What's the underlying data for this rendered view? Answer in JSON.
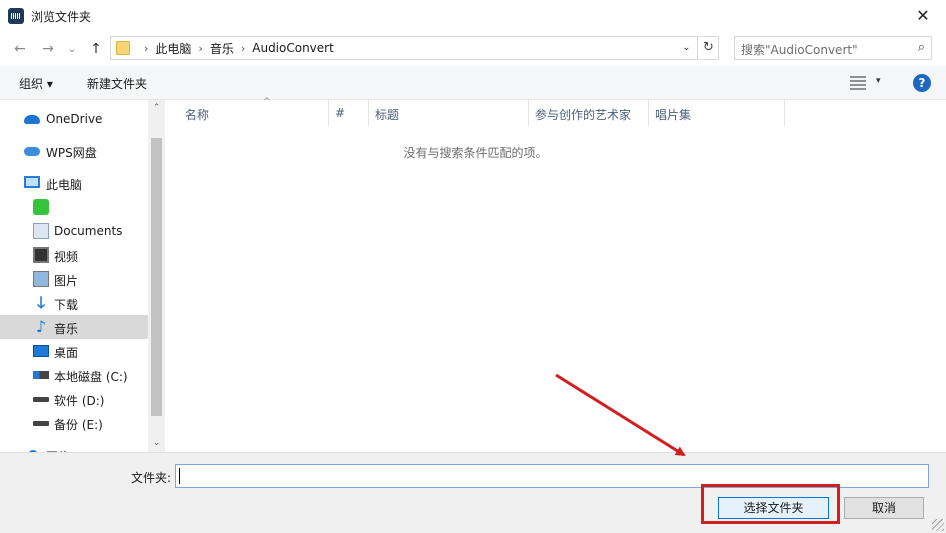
{
  "window": {
    "title": "浏览文件夹",
    "close_glyph": "✕"
  },
  "nav": {
    "back_glyph": "←",
    "forward_glyph": "→",
    "recent_glyph": "⌄",
    "up_glyph": "↑",
    "breadcrumbs": [
      "此电脑",
      "音乐",
      "AudioConvert"
    ],
    "breadcrumb_sep": "›",
    "dropdown_glyph": "⌄",
    "refresh_glyph": "↻",
    "search_placeholder": "搜索\"AudioConvert\"",
    "search_glyph": "⌕"
  },
  "toolbar": {
    "organize_label": "组织 ▾",
    "new_folder_label": "新建文件夹",
    "view_arrow": "▾",
    "help_glyph": "?"
  },
  "sidebar": {
    "items": [
      {
        "label": "OneDrive"
      },
      {
        "label": "WPS网盘"
      },
      {
        "label": "此电脑"
      },
      {
        "label": ""
      },
      {
        "label": "Documents"
      },
      {
        "label": "视频"
      },
      {
        "label": "图片"
      },
      {
        "label": "下载"
      },
      {
        "label": "音乐"
      },
      {
        "label": "桌面"
      },
      {
        "label": "本地磁盘 (C:)"
      },
      {
        "label": "软件 (D:)"
      },
      {
        "label": "备份 (E:)"
      },
      {
        "label": "网络"
      }
    ],
    "selected": "音乐",
    "down_arrow_glyph": "🡓",
    "music_glyph": "♪"
  },
  "scrollbar": {
    "up_glyph": "⌃",
    "down_glyph": "⌄"
  },
  "columns": [
    {
      "label": "名称"
    },
    {
      "label": "#"
    },
    {
      "label": "标题"
    },
    {
      "label": "参与创作的艺术家"
    },
    {
      "label": "唱片集"
    }
  ],
  "sort_glyph": "^",
  "empty_message": "没有与搜索条件匹配的项。",
  "footer": {
    "folder_label": "文件夹:",
    "folder_value": "",
    "select_button": "选择文件夹",
    "cancel_button": "取消"
  },
  "annotation": {
    "color": "#d11f1f"
  }
}
